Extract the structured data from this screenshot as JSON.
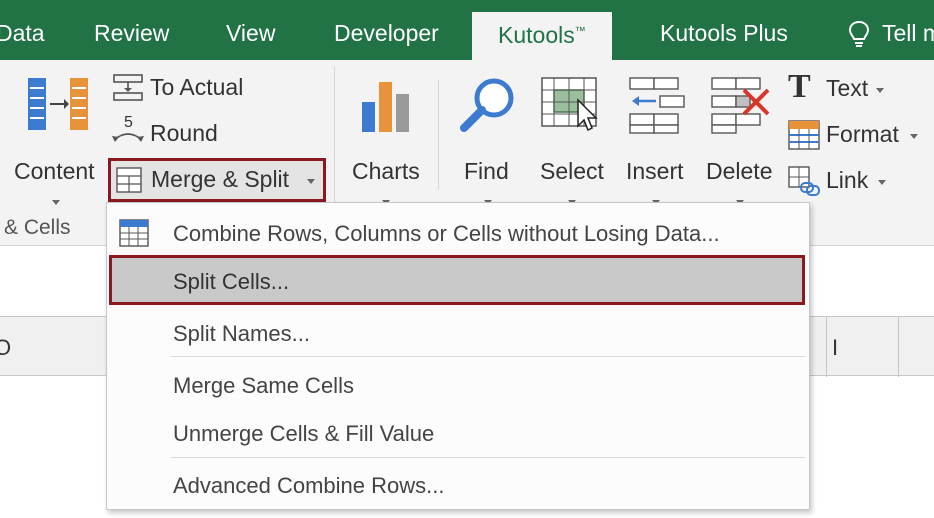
{
  "tabs": [
    {
      "label": "Data"
    },
    {
      "label": "Review"
    },
    {
      "label": "View"
    },
    {
      "label": "Developer"
    },
    {
      "label": "Kutools",
      "mark": "™"
    },
    {
      "label": "Kutools Plus"
    },
    {
      "label": "Tell m"
    }
  ],
  "ribbon": {
    "to_actual": "To Actual",
    "round": "Round",
    "round_glyph": "5",
    "content": "Content",
    "merge_split": "Merge & Split",
    "group_label": "& Cells",
    "charts": "Charts",
    "find": "Find",
    "select": "Select",
    "insert": "Insert",
    "delete": "Delete",
    "text": "Text",
    "format": "Format",
    "link": "Link"
  },
  "column_headers": [
    "O",
    "I"
  ],
  "menu": {
    "items": [
      {
        "label": "Combine Rows, Columns or Cells without Losing Data..."
      },
      {
        "label": "Split Cells..."
      },
      {
        "label": "Split Names..."
      },
      {
        "label": "Merge Same Cells"
      },
      {
        "label": "Unmerge Cells & Fill Value"
      },
      {
        "label": "Advanced Combine Rows..."
      }
    ]
  },
  "colors": {
    "tab_bar": "#217346",
    "highlight_border": "#8b1a1f",
    "icon_blue": "#3d7bd1",
    "icon_orange": "#e8933a",
    "icon_red": "#d9362b"
  }
}
